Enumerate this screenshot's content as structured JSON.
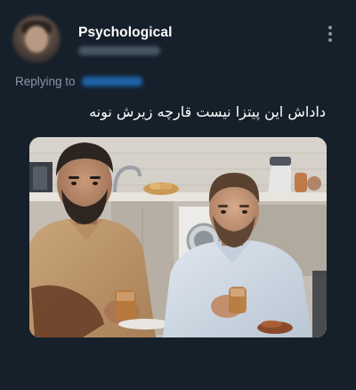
{
  "tweet": {
    "display_name": "Psychological",
    "replying_label": "Replying to",
    "text": "داداش این پیتزا نیست قارچه زیرش نونه"
  },
  "icons": {
    "more": "more-vertical-icon"
  },
  "colors": {
    "background": "#15202b",
    "text_primary": "#ffffff",
    "text_secondary": "#8899a6",
    "link": "#1d9bf0"
  }
}
